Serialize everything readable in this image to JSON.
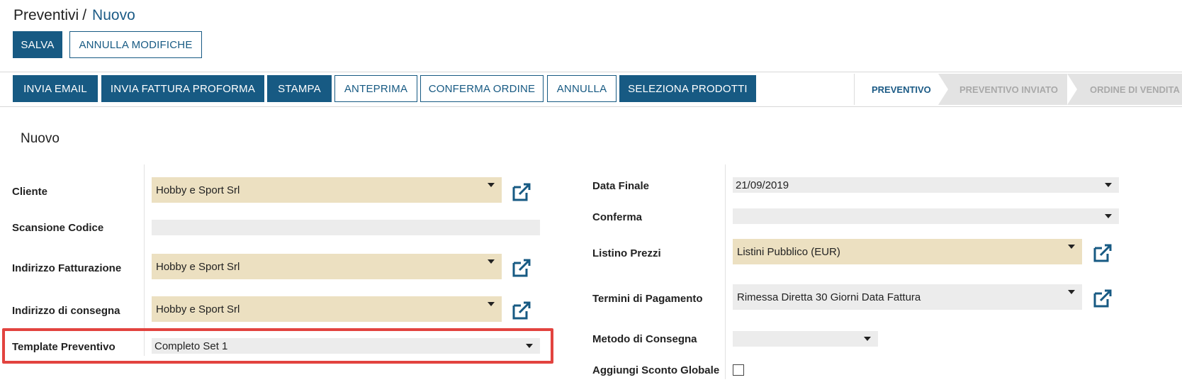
{
  "breadcrumb": {
    "root": "Preventivi",
    "separator": "/",
    "current": "Nuovo"
  },
  "header_buttons": {
    "save": "SALVA",
    "discard": "ANNULLA MODIFICHE"
  },
  "actions": {
    "send_email": "INVIA EMAIL",
    "send_proforma": "INVIA FATTURA PROFORMA",
    "print": "STAMPA",
    "preview": "ANTEPRIMA",
    "confirm_order": "CONFERMA ORDINE",
    "cancel": "ANNULLA",
    "select_products": "SELEZIONA PRODOTTI"
  },
  "statusbar": {
    "stages": [
      "PREVENTIVO",
      "PREVENTIVO INVIATO",
      "ORDINE DI VENDITA"
    ],
    "active": "PREVENTIVO"
  },
  "form": {
    "title": "Nuovo",
    "left": {
      "cliente": {
        "label": "Cliente",
        "value": "Hobby e Sport Srl"
      },
      "scansione": {
        "label": "Scansione Codice",
        "value": ""
      },
      "fatturazione": {
        "label": "Indirizzo Fatturazione",
        "value": "Hobby e Sport Srl"
      },
      "consegna": {
        "label": "Indirizzo di consegna",
        "value": "Hobby e Sport Srl"
      },
      "template": {
        "label": "Template Preventivo",
        "value": "Completo Set 1"
      }
    },
    "right": {
      "data_finale": {
        "label": "Data Finale",
        "value": "21/09/2019"
      },
      "conferma": {
        "label": "Conferma",
        "value": ""
      },
      "listino": {
        "label": "Listino Prezzi",
        "value": "Listini Pubblico (EUR)"
      },
      "termini": {
        "label": "Termini di Pagamento",
        "value": "Rimessa Diretta 30 Giorni Data Fattura"
      },
      "metodo": {
        "label": "Metodo di Consegna",
        "value": ""
      },
      "sconto": {
        "label": "Aggiungi Sconto Globale",
        "checked": false
      }
    }
  },
  "colors": {
    "primary": "#175a83",
    "required_field": "#ece0c1",
    "field": "#ececec",
    "highlight": "#e2433f"
  },
  "icons": {
    "external_link": "external-link-icon",
    "dropdown": "chevron-down-icon"
  }
}
